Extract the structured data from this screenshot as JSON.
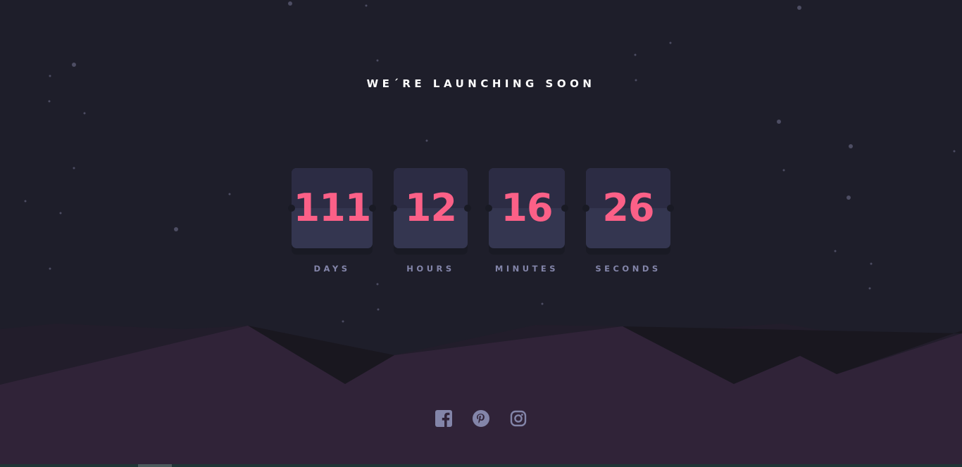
{
  "headline": "WE´RE LAUNCHING SOON",
  "countdown": [
    {
      "value": "111",
      "label": "DAYS"
    },
    {
      "value": "12",
      "label": "HOURS"
    },
    {
      "value": "16",
      "label": "MINUTES"
    },
    {
      "value": "26",
      "label": "SECONDS"
    }
  ],
  "social": [
    {
      "icon": "facebook-icon"
    },
    {
      "icon": "pinterest-icon"
    },
    {
      "icon": "instagram-icon"
    }
  ],
  "colors": {
    "background": "#1e1e2a",
    "accent": "#fb6087",
    "label": "#8385a9",
    "card": "#343650",
    "card_top": "#2c2c44",
    "hills": "#302338"
  }
}
